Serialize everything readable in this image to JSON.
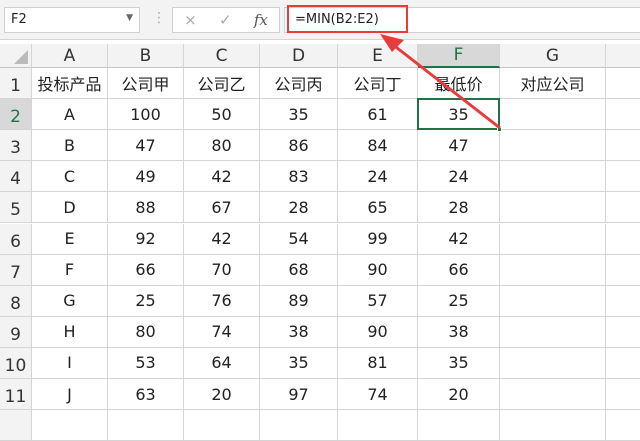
{
  "name_box": "F2",
  "formula_bar": {
    "cancel_icon": "×",
    "enter_icon": "✓",
    "fx_label": "fx",
    "formula": "=MIN(B2:E2)"
  },
  "columns": [
    "A",
    "B",
    "C",
    "D",
    "E",
    "F",
    "G"
  ],
  "row_numbers": [
    "1",
    "2",
    "3",
    "4",
    "5",
    "6",
    "7",
    "8",
    "9",
    "10",
    "11"
  ],
  "header_row": [
    "投标产品",
    "公司甲",
    "公司乙",
    "公司丙",
    "公司丁",
    "最低价",
    "对应公司"
  ],
  "rows": [
    [
      "A",
      "100",
      "50",
      "35",
      "61",
      "35",
      ""
    ],
    [
      "B",
      "47",
      "80",
      "86",
      "84",
      "47",
      ""
    ],
    [
      "C",
      "49",
      "42",
      "83",
      "24",
      "24",
      ""
    ],
    [
      "D",
      "88",
      "67",
      "28",
      "65",
      "28",
      ""
    ],
    [
      "E",
      "92",
      "42",
      "54",
      "99",
      "42",
      ""
    ],
    [
      "F",
      "66",
      "70",
      "68",
      "90",
      "66",
      ""
    ],
    [
      "G",
      "25",
      "76",
      "89",
      "57",
      "25",
      ""
    ],
    [
      "H",
      "80",
      "74",
      "38",
      "90",
      "38",
      ""
    ],
    [
      "I",
      "53",
      "64",
      "35",
      "81",
      "35",
      ""
    ],
    [
      "J",
      "63",
      "20",
      "97",
      "74",
      "20",
      ""
    ]
  ],
  "colors": {
    "accent": "#217346",
    "annotation": "#e83b3b"
  }
}
